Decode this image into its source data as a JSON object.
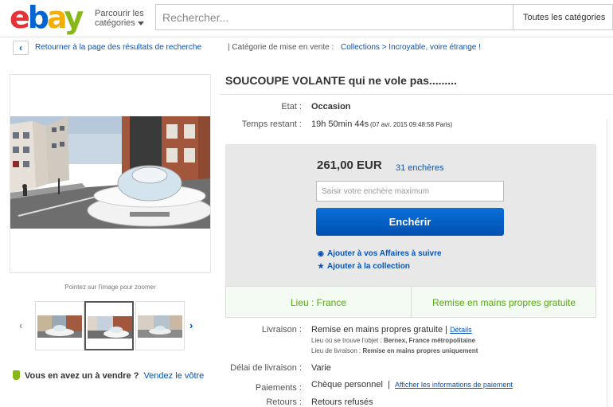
{
  "colors": {
    "brand_red": "#e53238",
    "brand_blue": "#0064d2",
    "brand_yellow": "#f5af02",
    "brand_green": "#86b817",
    "link_blue": "#0654ba",
    "location_green": "#5ba71b",
    "bid_button": "#0064d2",
    "bid_panel_bg": "#e8e8e8"
  },
  "header": {
    "logo_letters": [
      "e",
      "b",
      "a",
      "y"
    ],
    "browse_line1": "Parcourir les",
    "browse_line2": "catégories",
    "search_placeholder": "Rechercher...",
    "category_select": "Toutes les catégories"
  },
  "breadcrumb": {
    "back_link": "Retourner à la page des résultats de recherche",
    "category_label": "| Catégorie de mise en vente :",
    "trail": "Collections > Incroyable, voire étrange !"
  },
  "gallery": {
    "zoom_hint": "Pointez sur l'image pour zoomer",
    "thumb_count": 3,
    "active_thumb": 2
  },
  "sell": {
    "question": "Vous en avez un à vendre ?",
    "link": "Vendez le vôtre"
  },
  "item": {
    "title": "SOUCOUPE VOLANTE qui ne vole pas.........",
    "condition_label": "Etat :",
    "condition_value": "Occasion",
    "time_label": "Temps restant :",
    "time_value": "19h 50min 44s",
    "time_detail": "(07 avr. 2015  09:48:58 Paris)"
  },
  "bid": {
    "price": "261,00 EUR",
    "bids_count": "31 enchères",
    "input_placeholder": "Saisir votre enchère maximum",
    "button": "Enchérir",
    "watch_link": "Ajouter à vos Affaires à suivre",
    "collection_link": "Ajouter à la collection"
  },
  "location": {
    "left": "Lieu : France",
    "right": "Remise en mains propres gratuite"
  },
  "shipping": {
    "label": "Livraison :",
    "value": "Remise en mains propres gratuite",
    "sep": "|",
    "details_link": "Détails",
    "item_location_label": "Lieu où se trouve l'objet :",
    "item_location_value": "Bernex, France métropolitaine",
    "delivery_place_label": "Lieu de livraison :",
    "delivery_place_value": "Remise en mains propres uniquement"
  },
  "delivery_delay": {
    "label": "Délai de livraison :",
    "value": "Varie"
  },
  "payments": {
    "label": "Paiements :",
    "value": "Chèque personnel",
    "sep": "|",
    "link": "Afficher les informations de paiement"
  },
  "returns": {
    "label": "Retours :",
    "value": "Retours refusés"
  }
}
